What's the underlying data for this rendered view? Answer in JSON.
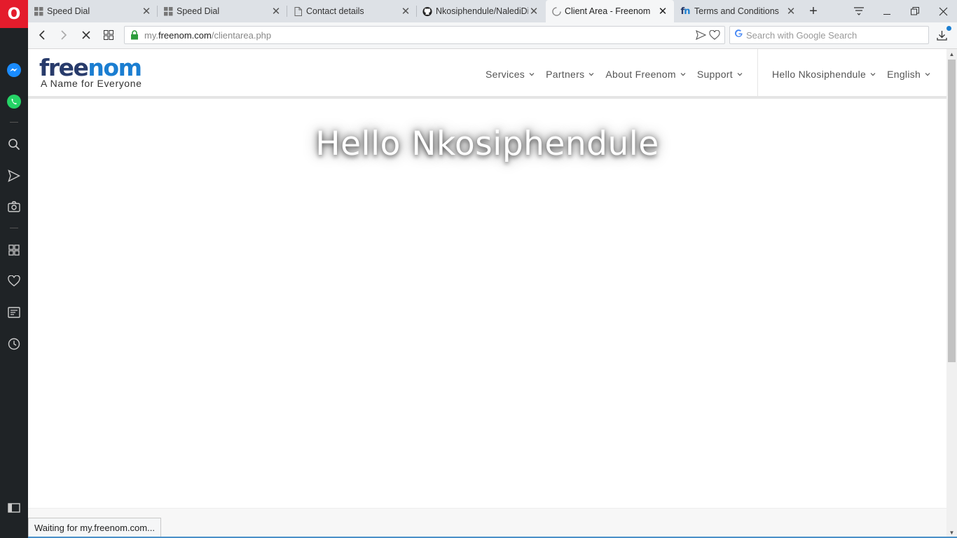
{
  "browser": {
    "brand": "O",
    "tabs": [
      {
        "label": "Speed Dial",
        "icon": "speed-dial-icon",
        "active": false
      },
      {
        "label": "Speed Dial",
        "icon": "speed-dial-icon",
        "active": false
      },
      {
        "label": "Contact details",
        "icon": "document-icon",
        "active": false
      },
      {
        "label": "Nkosiphendule/NalediDi",
        "icon": "github-icon",
        "active": false
      },
      {
        "label": "Client Area - Freenom",
        "icon": "loading-icon",
        "active": true
      },
      {
        "label": "Terms and Conditions",
        "icon": "freenom-fn-icon",
        "active": false
      }
    ],
    "url_prefix": "my.",
    "url_host": "freenom.com",
    "url_path": "/clientarea.php",
    "search_placeholder": "Search with Google Search",
    "status_text": "Waiting for my.freenom.com...",
    "accent": "#e41c2c"
  },
  "site": {
    "logo_dark": "free",
    "logo_light": "nom",
    "logo_tagline": "A Name for Everyone",
    "nav": [
      "Services",
      "Partners",
      "About Freenom",
      "Support"
    ],
    "user_menu": "Hello Nkosiphendule",
    "language": "English",
    "hero": "Hello Nkosiphendule",
    "brand_blue": "#1b7ed1",
    "brand_dark": "#283b6b"
  }
}
